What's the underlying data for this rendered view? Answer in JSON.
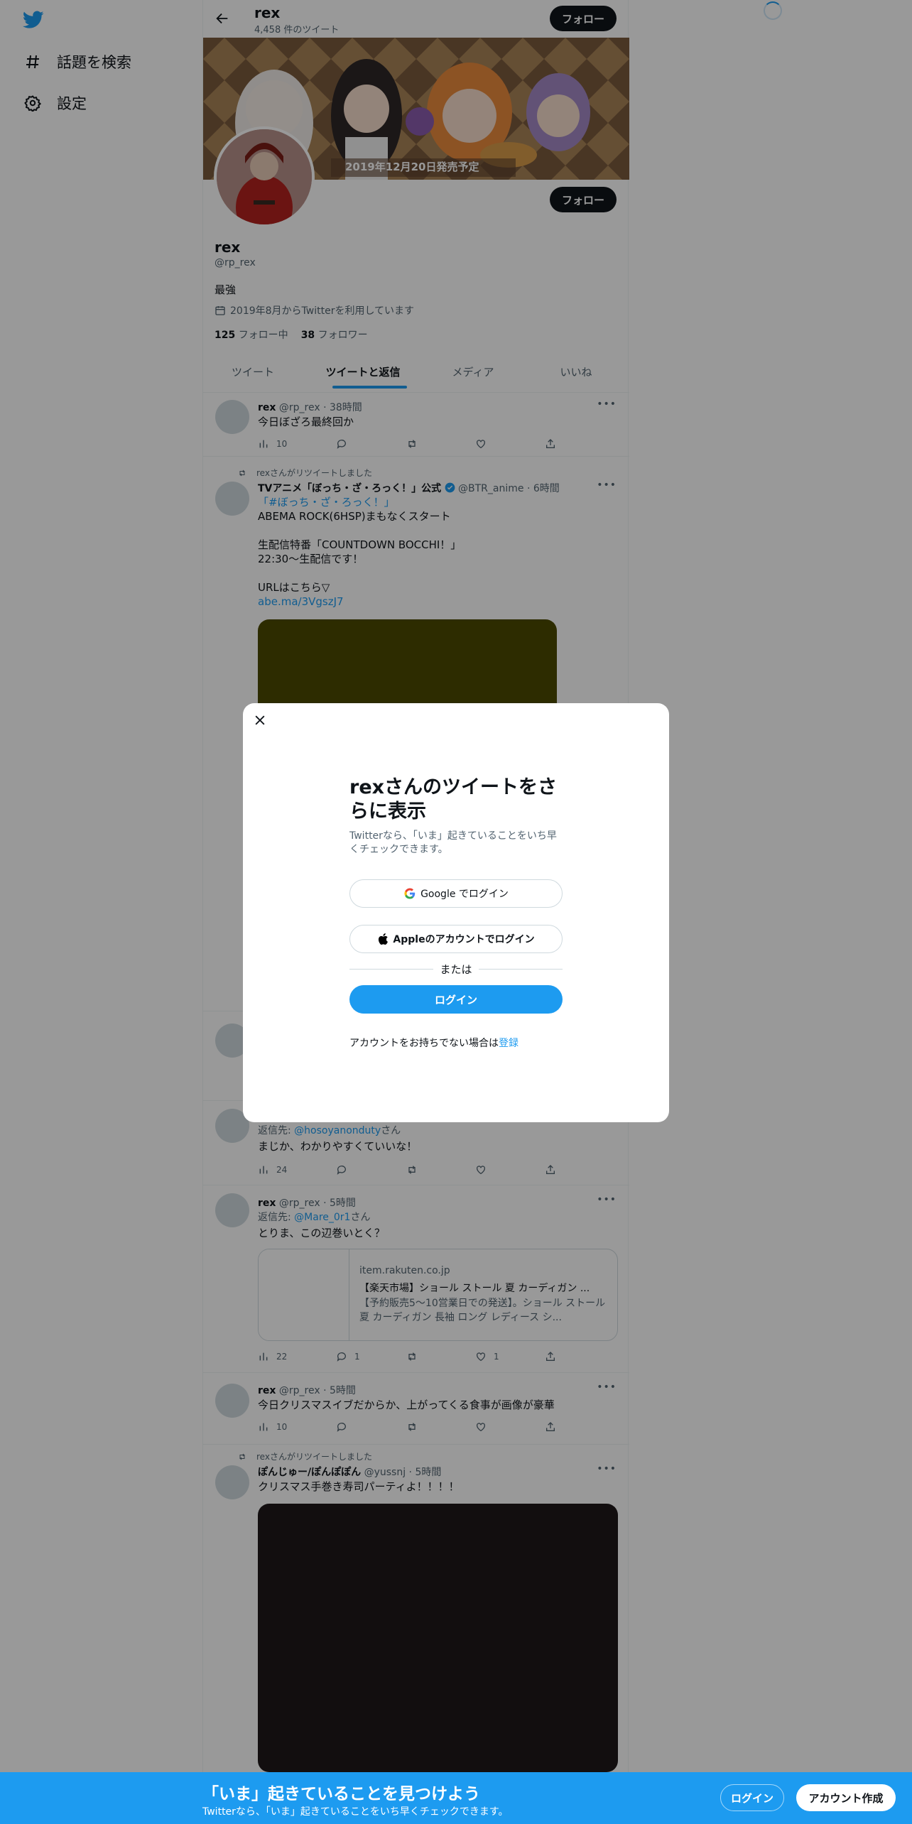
{
  "sidebar": {
    "explore_label": "話題を検索",
    "settings_label": "設定"
  },
  "header": {
    "name": "rex",
    "tweet_count": "4,458 件のツイート",
    "follow_label": "フォロー"
  },
  "banner": {
    "caption": "2019年12月20日発売予定"
  },
  "profile": {
    "name": "rex",
    "handle": "@rp_rex",
    "bio": "最強",
    "joined": "2019年8月からTwitterを利用しています",
    "following_count": "125",
    "following_label": "フォロー中",
    "followers_count": "38",
    "followers_label": "フォロワー",
    "follow_label": "フォロー"
  },
  "tabs": [
    "ツイート",
    "ツイートと返信",
    "メディア",
    "いいね"
  ],
  "tweets": [
    {
      "name": "rex",
      "meta": "@rp_rex · 38時間",
      "text": "今日ぼざろ最終回か",
      "views": "10",
      "replies": "",
      "likes": ""
    },
    {
      "rt_label": "rexさんがリツイートしました",
      "name": "TVアニメ「ぼっち・ざ・ろっく！」公式",
      "meta": "@BTR_anime · 6時間",
      "hashtag": "「#ぼっち・ざ・ろっく！」",
      "lines": [
        "ABEMA ROCK(6HSP)まもなくスタート",
        "",
        "生配信特番「COUNTDOWN BOCCHI！」",
        "22:30～生配信です！",
        "",
        "URLはこちら▽"
      ],
      "link": "abe.ma/3VgszJ7",
      "media_color": "#4c4a00"
    },
    {
      "reply_prefix": "返信先: ",
      "reply_to": "@hosoyanonduty",
      "reply_suffix": "さん",
      "text": "まじか、わかりやすくていいな！",
      "views": "24"
    },
    {
      "name": "rex",
      "meta": "@rp_rex · 5時間",
      "reply_prefix": "返信先: ",
      "reply_to": "@Mare_0r1",
      "reply_suffix": "さん",
      "text": "とりま、この辺巻いとく？",
      "card": {
        "domain": "item.rakuten.co.jp",
        "title": "【楽天市場】ショール ストール 夏 カーディガン ...",
        "desc": "【予約販売5〜10営業日での発送】。ショール ストール 夏 カーディガン 長袖 ロング レディース シ..."
      },
      "views": "22",
      "replies": "1",
      "likes": "1"
    },
    {
      "name": "rex",
      "meta": "@rp_rex · 5時間",
      "text": "今日クリスマスイブだからか、上がってくる食事が画像が豪華",
      "views": "10"
    },
    {
      "rt_label": "rexさんがリツイートしました",
      "name": "ぽんじゅー/ぽんぽぽん",
      "meta": "@yussnj · 5時間",
      "text": "クリスマス手巻き寿司パーティよ！！！！",
      "media_color": "#1e1819"
    }
  ],
  "modal": {
    "title": "rexさんのツイートをさらに表示",
    "subtitle": "Twitterなら、「いま」起きていることをいち早くチェックできます。",
    "google_label": "Google でログイン",
    "apple_label": "Appleのアカウントでログイン",
    "or_label": "または",
    "login_label": "ログイン",
    "signup_prompt": "アカウントをお持ちでない場合は",
    "signup_link": "登録"
  },
  "bottom_bar": {
    "title": "「いま」起きていることを見つけよう",
    "subtitle": "Twitterなら、「いま」起きていることをいち早くチェックできます。",
    "login_label": "ログイン",
    "signup_label": "アカウント作成"
  },
  "colors": {
    "accent": "#1d9bf0",
    "text": "#0f1419",
    "muted": "#536471",
    "overlay": "rgba(0,0,0,0.4)"
  }
}
